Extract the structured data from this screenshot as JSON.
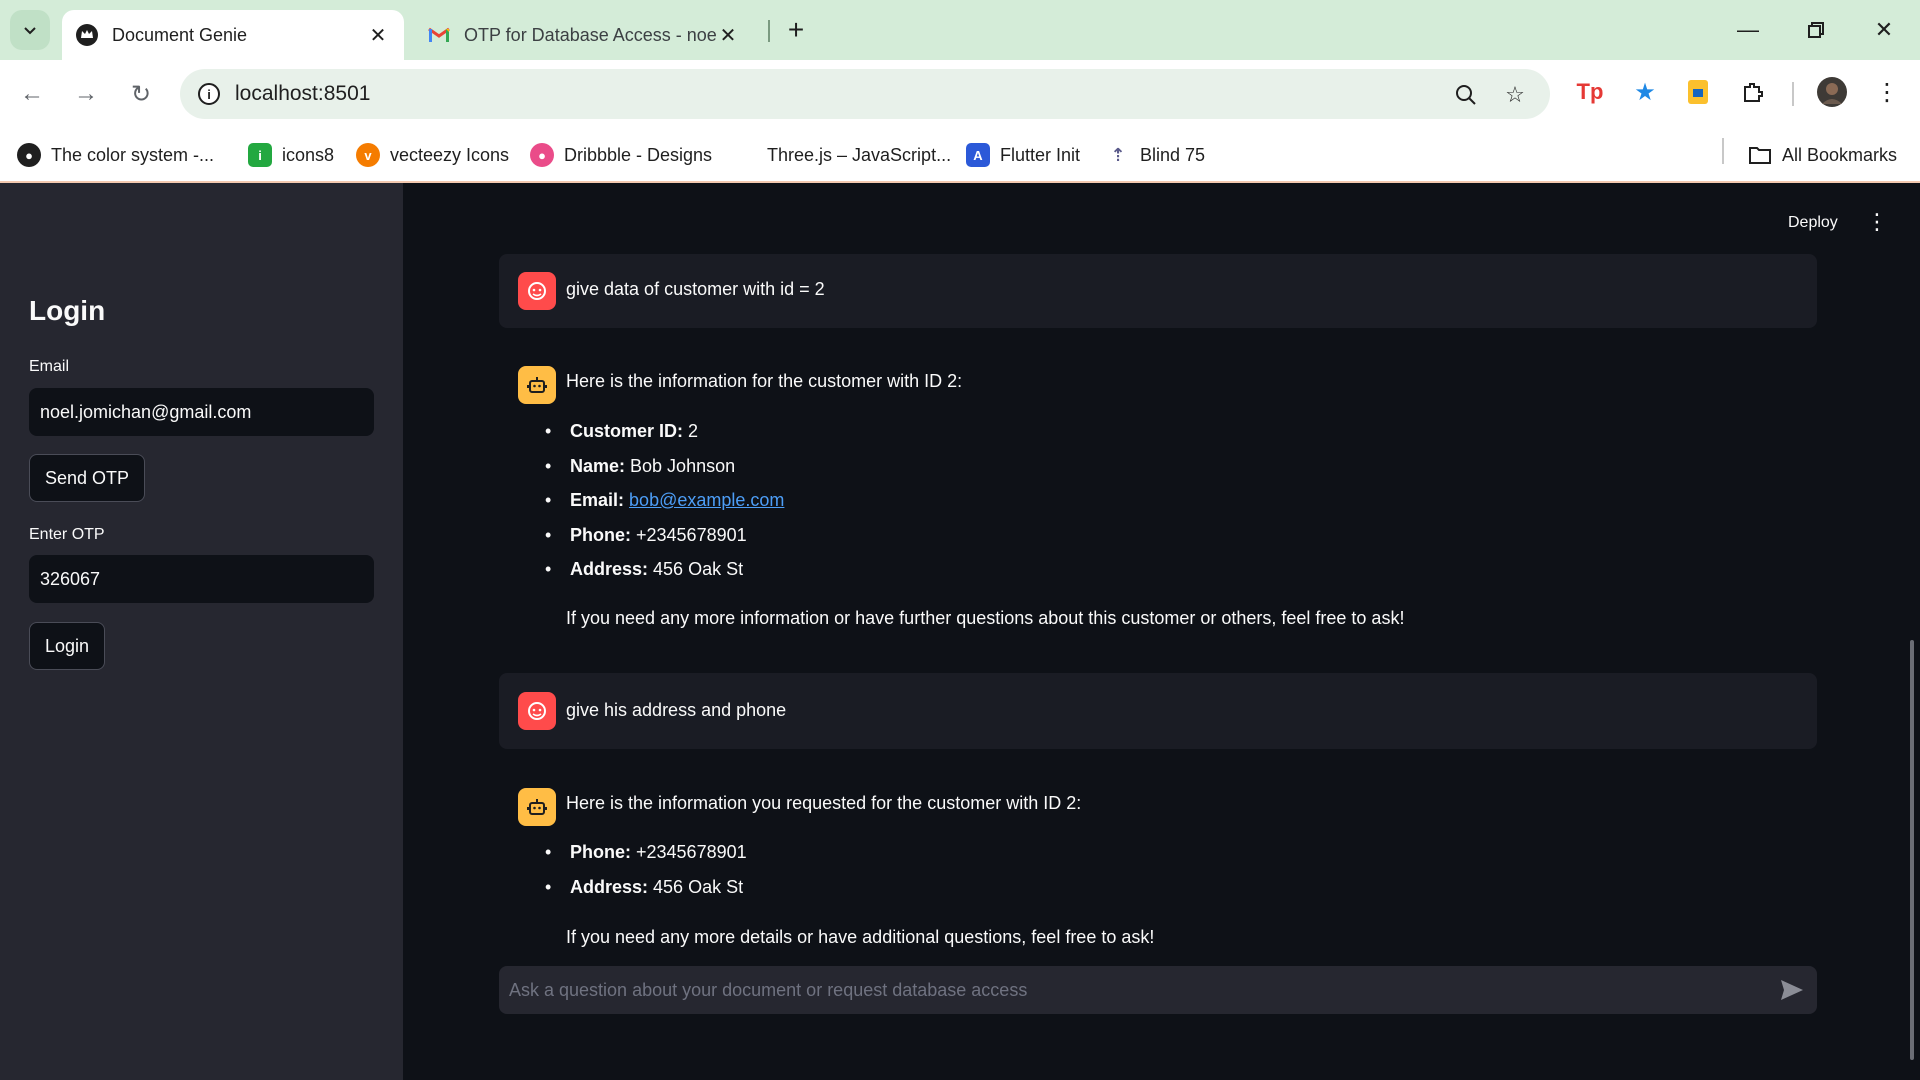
{
  "browser": {
    "tabs": [
      {
        "title": "Document Genie",
        "active": true
      },
      {
        "title": "OTP for Database Access - noel",
        "active": false
      }
    ],
    "url": "localhost:8501",
    "bookmarks": [
      {
        "label": "The color system -...",
        "icon": "github-icon"
      },
      {
        "label": "icons8",
        "icon": "icons8-icon"
      },
      {
        "label": "vecteezy Icons",
        "icon": "vecteezy-icon"
      },
      {
        "label": "Dribbble - Designs",
        "icon": "dribbble-icon"
      },
      {
        "label": "Three.js – JavaScript...",
        "icon": "threejs-icon"
      },
      {
        "label": "Flutter Init",
        "icon": "flutter-icon"
      },
      {
        "label": "Blind 75",
        "icon": "rocket-icon"
      }
    ],
    "all_bookmarks": "All Bookmarks"
  },
  "sidebar": {
    "title": "Login",
    "email_label": "Email",
    "email_value": "noel.jomichan@gmail.com",
    "send_otp_label": "Send OTP",
    "otp_label": "Enter OTP",
    "otp_value": "326067",
    "login_label": "Login"
  },
  "header": {
    "deploy_label": "Deploy",
    "menu_icon": "⋮"
  },
  "chat": {
    "messages": [
      {
        "role": "user",
        "text": "give data of customer with id = 2"
      },
      {
        "role": "assistant",
        "intro": "Here is the information for the customer with ID 2:",
        "items": [
          {
            "key": "Customer ID:",
            "value": " 2"
          },
          {
            "key": "Name:",
            "value": " Bob Johnson"
          },
          {
            "key": "Email:",
            "value": "bob@example.com"
          },
          {
            "key": "Phone:",
            "value": " +2345678901"
          },
          {
            "key": "Address:",
            "value": " 456 Oak St"
          }
        ],
        "outro": "If you need any more information or have further questions about this customer or others, feel free to ask!"
      },
      {
        "role": "user",
        "text": "give his address and phone"
      },
      {
        "role": "assistant",
        "intro": "Here is the information you requested for the customer with ID 2:",
        "items": [
          {
            "key": "Phone:",
            "value": " +2345678901"
          },
          {
            "key": "Address:",
            "value": " 456 Oak St"
          }
        ],
        "outro": "If you need any more details or have additional questions, feel free to ask!"
      }
    ],
    "input_placeholder": "Ask a question about your document or request database access"
  },
  "colors": {
    "sidebar_bg": "#262730",
    "main_bg": "#0e1117",
    "user_avatar": "#ff4b4b",
    "bot_avatar": "#ffbd45",
    "link": "#4d9ef7",
    "browser_frame": "#d4ecd8"
  }
}
